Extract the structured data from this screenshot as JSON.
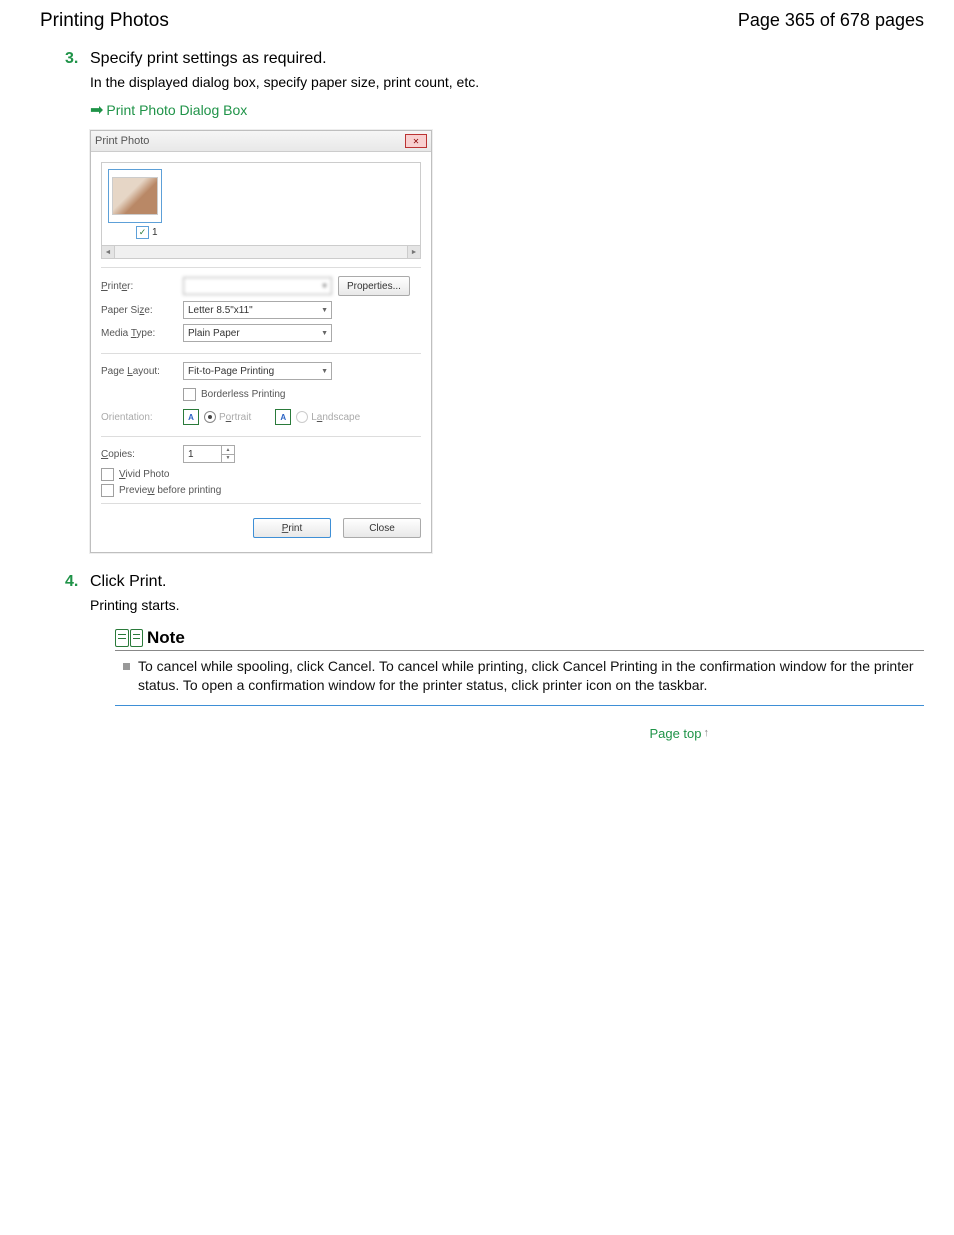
{
  "header": {
    "title": "Printing Photos",
    "page_info": "Page 365 of 678 pages"
  },
  "steps": [
    {
      "num": "3.",
      "title": "Specify print settings as required.",
      "desc": "In the displayed dialog box, specify paper size, print count, etc.",
      "link": "Print Photo Dialog Box"
    },
    {
      "num": "4.",
      "title": "Click Print.",
      "desc": "Printing starts."
    }
  ],
  "dialog": {
    "title": "Print Photo",
    "thumb_index": "1",
    "labels": {
      "printer": "Printer:",
      "paper_size": "Paper Size:",
      "media_type": "Media Type:",
      "page_layout": "Page Layout:",
      "orientation": "Orientation:",
      "copies": "Copies:"
    },
    "values": {
      "printer": "",
      "paper_size": "Letter 8.5\"x11\"",
      "media_type": "Plain Paper",
      "page_layout": "Fit-to-Page Printing",
      "borderless": "Borderless Printing",
      "portrait": "Portrait",
      "landscape": "Landscape",
      "copies": "1",
      "vivid": "Vivid Photo",
      "preview": "Preview before printing"
    },
    "buttons": {
      "properties": "Properties...",
      "print": "Print",
      "close": "Close"
    }
  },
  "note": {
    "title": "Note",
    "item": "To cancel while spooling, click Cancel. To cancel while printing, click Cancel Printing in the confirmation window for the printer status. To open a confirmation window for the printer status, click printer icon on the taskbar."
  },
  "page_top": "Page top"
}
